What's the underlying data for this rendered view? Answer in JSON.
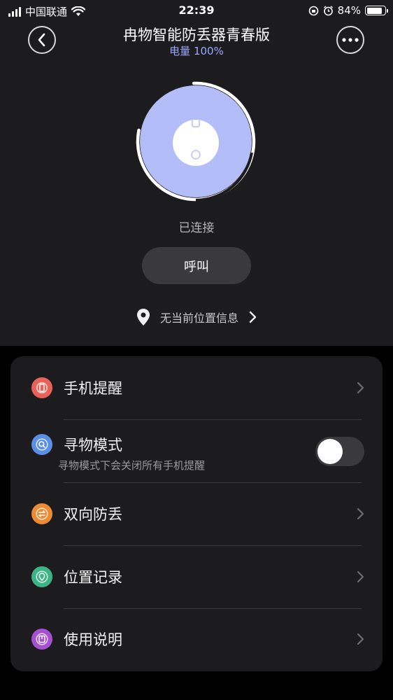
{
  "status_bar": {
    "carrier": "中国联通",
    "time": "22:39",
    "battery_percent": "84%",
    "battery_level": 0.84
  },
  "header": {
    "title": "冉物智能防丢器青春版",
    "subtitle": "电量 100%",
    "back_icon": "chevron-left-icon",
    "more_icon": "more-dots-icon"
  },
  "device": {
    "status": "已连接",
    "call_label": "呼叫",
    "location_text": "无当前位置信息"
  },
  "menu": {
    "items": [
      {
        "label": "手机提醒",
        "icon": "phone-icon",
        "color": "#e8625a"
      },
      {
        "label": "寻物模式",
        "sub": "寻物模式下会关闭所有手机提醒",
        "icon": "search-icon",
        "color": "#5b8ee6",
        "toggle": false
      },
      {
        "label": "双向防丢",
        "icon": "swap-icon",
        "color": "#ec8b33"
      },
      {
        "label": "位置记录",
        "icon": "map-pin-icon",
        "color": "#3bb586"
      },
      {
        "label": "使用说明",
        "icon": "manual-icon",
        "color": "#a64fd1"
      }
    ]
  },
  "colors": {
    "accent": "#9aa6ff",
    "device_fill": "#b3bdf7"
  }
}
